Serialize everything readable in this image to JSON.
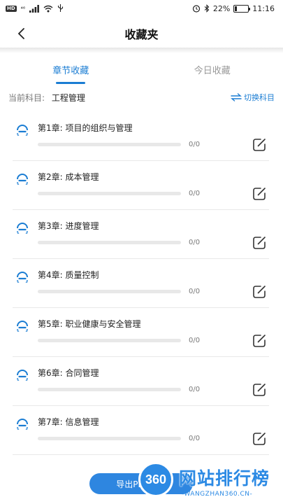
{
  "status_bar": {
    "hd": "HD",
    "net": "⁴⁶",
    "battery": "22%",
    "time": "11:16",
    "battery_level": 0.22
  },
  "header": {
    "title": "收藏夹"
  },
  "tabs": [
    {
      "label": "章节收藏",
      "active": true
    },
    {
      "label": "今日收藏",
      "active": false
    }
  ],
  "subject": {
    "label": "当前科目:",
    "value": "工程管理",
    "switch_label": "切换科目"
  },
  "chapters": [
    {
      "title": "第1章:  项目的组织与管理",
      "count": "0/0",
      "progress": 0
    },
    {
      "title": "第2章:  成本管理",
      "count": "0/0",
      "progress": 0
    },
    {
      "title": "第3章:  进度管理",
      "count": "0/0",
      "progress": 0
    },
    {
      "title": "第4章:  质量控制",
      "count": "0/0",
      "progress": 0
    },
    {
      "title": "第5章:  职业健康与安全管理",
      "count": "0/0",
      "progress": 0
    },
    {
      "title": "第6章:  合同管理",
      "count": "0/0",
      "progress": 0
    },
    {
      "title": "第7章:  信息管理",
      "count": "0/0",
      "progress": 0
    }
  ],
  "export_button": {
    "label": "导出PDF题目"
  },
  "watermark": {
    "badge": "360",
    "text": "网站排行榜",
    "url": "-WANGZHAN360.CN-"
  },
  "colors": {
    "accent": "#1b7dd3",
    "button": "#2e86e0"
  }
}
